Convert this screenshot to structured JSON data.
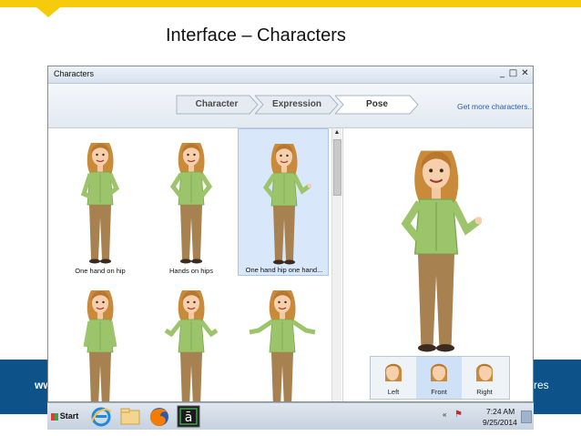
{
  "slide": {
    "title": "Interface – Characters",
    "band_left": "ww",
    "band_right": "res"
  },
  "window": {
    "title": "Characters",
    "controls": [
      "_",
      "□",
      "✕"
    ]
  },
  "toolbar": {
    "steps": [
      {
        "label": "Character",
        "active": false
      },
      {
        "label": "Expression",
        "active": false
      },
      {
        "label": "Pose",
        "active": true
      }
    ],
    "get_more_link": "Get more characters..."
  },
  "poses": [
    {
      "label": "One hand on hip",
      "selected": false
    },
    {
      "label": "Hands on hips",
      "selected": false
    },
    {
      "label": "One hand hip one hand...",
      "selected": true
    },
    {
      "label": "",
      "selected": false
    },
    {
      "label": "",
      "selected": false
    },
    {
      "label": "",
      "selected": false
    }
  ],
  "views": [
    {
      "label": "Left",
      "active": false
    },
    {
      "label": "Front",
      "active": true
    },
    {
      "label": "Right",
      "active": false
    }
  ],
  "taskbar": {
    "start_label": "Start",
    "icons": [
      "internet-explorer-icon",
      "folder-icon",
      "firefox-icon",
      "app-icon"
    ],
    "tray_arrow": "«",
    "time": "7:24 AM",
    "date": "9/25/2014"
  },
  "colors": {
    "top_bar": "#f5cb0c",
    "blue_band": "#0d5288",
    "shirt": "#9cc56b",
    "pants": "#a88150",
    "hair": "#c98a3a",
    "selected_bg": "#d9e7fa"
  }
}
